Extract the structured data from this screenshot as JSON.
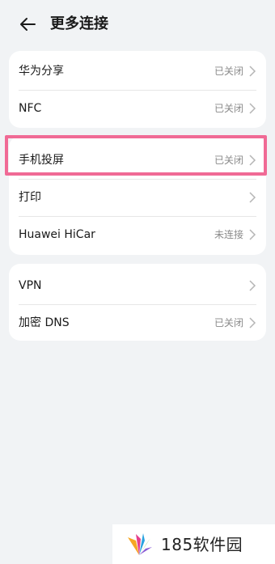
{
  "header": {
    "title": "更多连接",
    "back_icon": "arrow-left-icon"
  },
  "groups": [
    {
      "items": [
        {
          "label": "华为分享",
          "status": "已关闭"
        },
        {
          "label": "NFC",
          "status": "已关闭"
        }
      ]
    },
    {
      "items": [
        {
          "label": "手机投屏",
          "status": "已关闭"
        },
        {
          "label": "打印",
          "status": ""
        },
        {
          "label": "Huawei HiCar",
          "status": "未连接"
        }
      ]
    },
    {
      "items": [
        {
          "label": "VPN",
          "status": ""
        },
        {
          "label": "加密 DNS",
          "status": "已关闭"
        }
      ]
    }
  ],
  "highlight": {
    "target": "手机投屏",
    "color": "#f06a95"
  },
  "watermark": {
    "text": "185软件园",
    "logo": "fan-logo-icon"
  },
  "colors": {
    "background": "#f1f3f5",
    "card": "#ffffff",
    "muted_text": "#8a8a8a"
  }
}
